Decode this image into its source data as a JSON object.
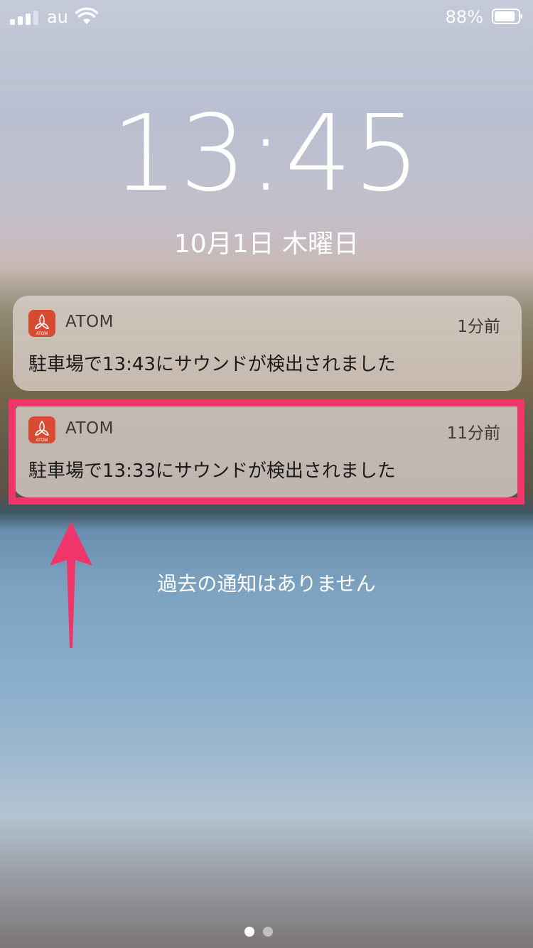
{
  "status_bar": {
    "carrier": "au",
    "battery_percent": "88%",
    "signal_bars": 3,
    "signal_bars_total": 4,
    "battery_level": 0.88
  },
  "lock_screen": {
    "time": "13:45",
    "date": "10月1日 木曜日",
    "no_older_notifications": "過去の通知はありません"
  },
  "notifications": [
    {
      "app": "ATOM",
      "time_ago": "1分前",
      "message": "駐車場で13:43にサウンドが検出されました",
      "highlighted": false
    },
    {
      "app": "ATOM",
      "time_ago": "11分前",
      "message": "駐車場で13:33にサウンドが検出されました",
      "highlighted": true
    }
  ],
  "annotation": {
    "highlight_color": "#f0356a",
    "arrow_color": "#f0356a"
  },
  "app_icon": {
    "color": "#d94a33",
    "icon_name": "atom-app-icon",
    "icon_text": "ATOM"
  },
  "page_indicator": {
    "pages": 2,
    "active_index": 0
  }
}
